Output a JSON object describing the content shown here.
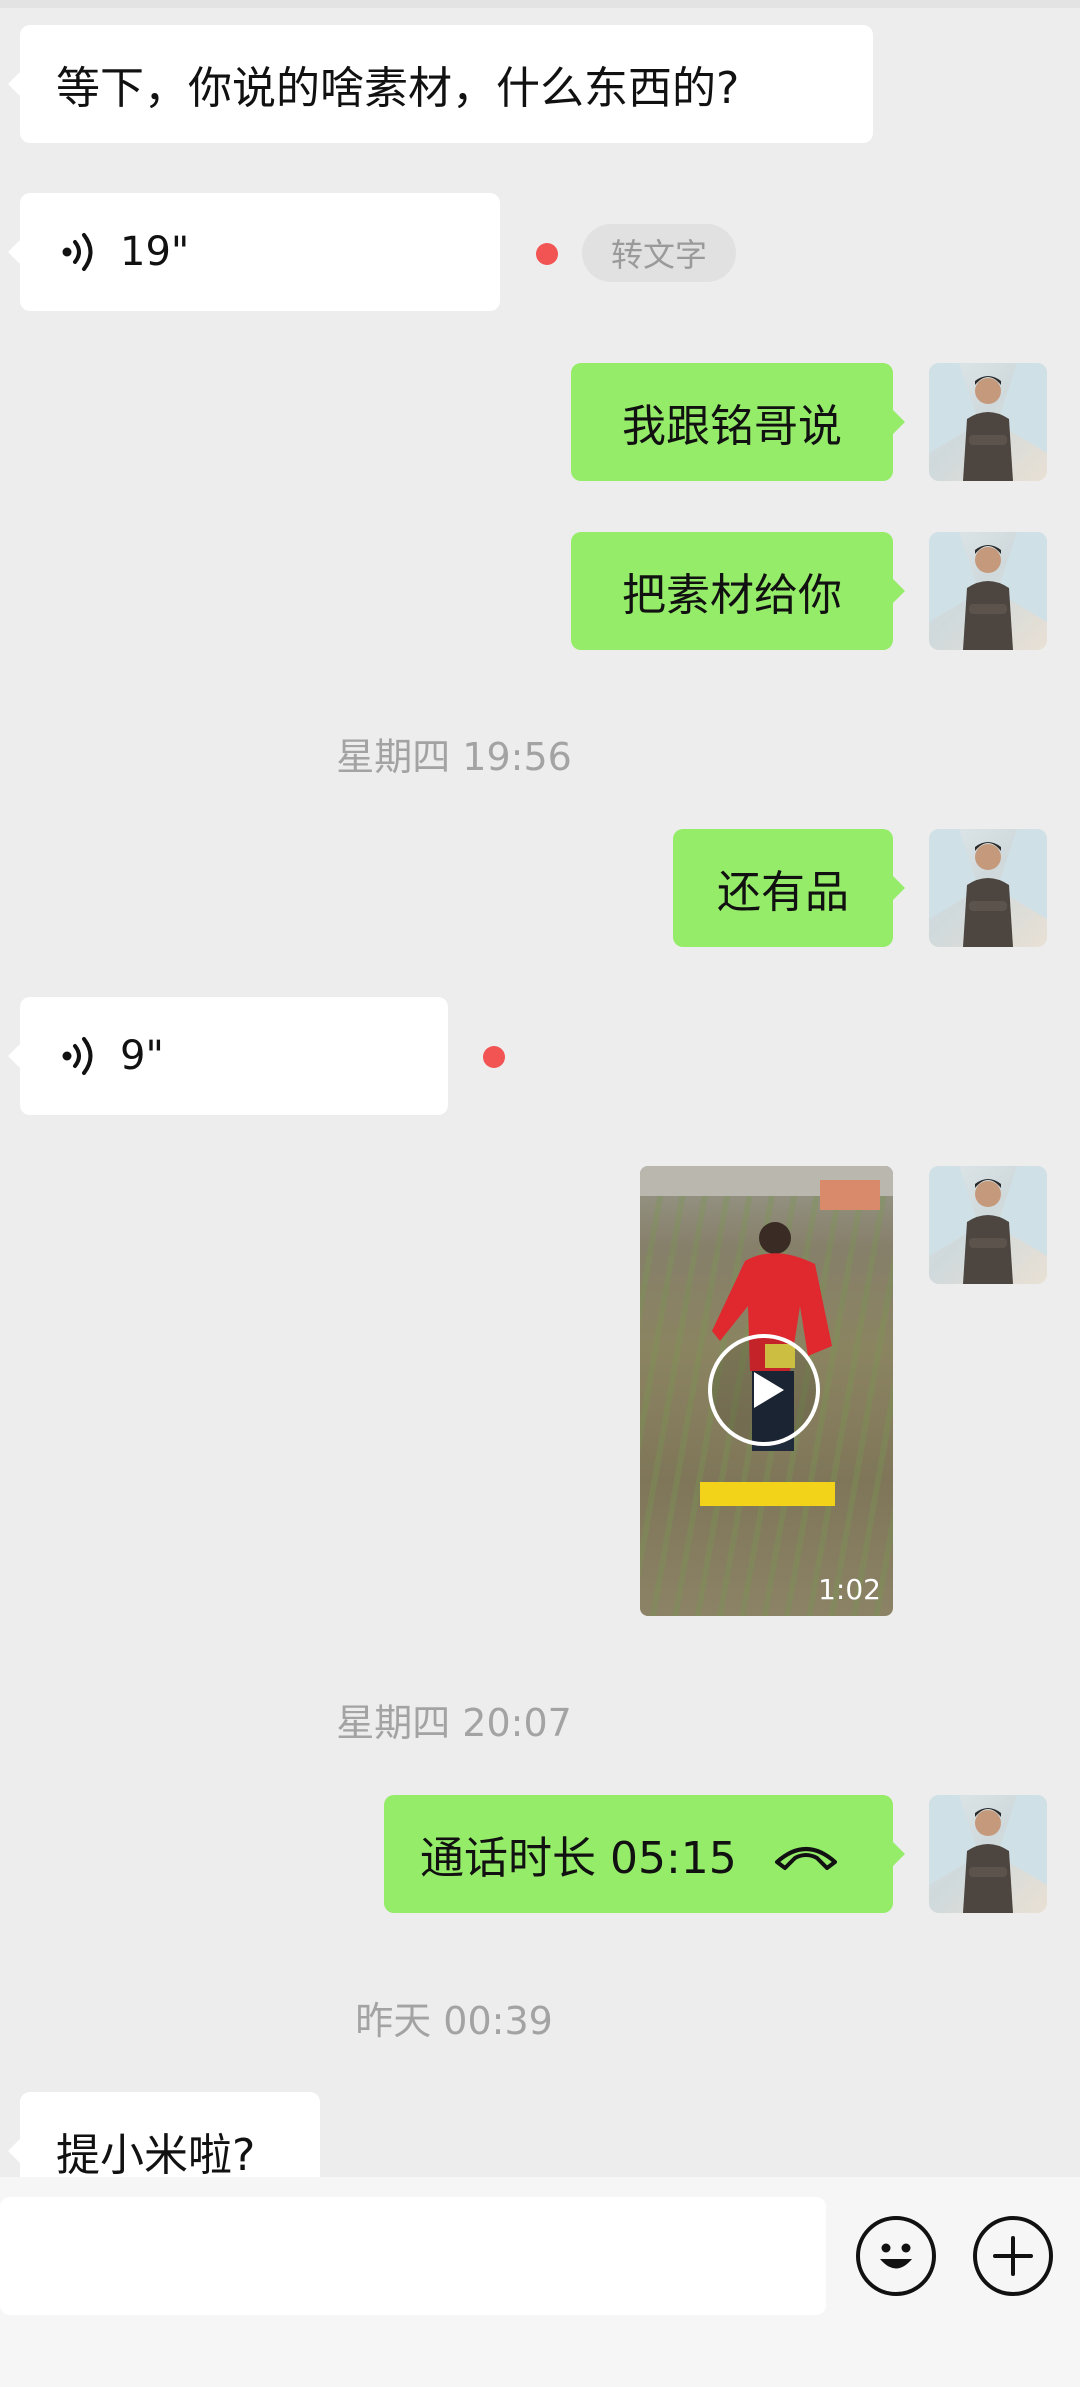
{
  "messages": {
    "m1": "等下，你说的啥素材，什么东西的?",
    "voice1_duration": "19\"",
    "to_text_label": "转文字",
    "m2": "我跟铭哥说",
    "m3": "把素材给你",
    "ts1": "星期四 19:56",
    "m4": "还有品",
    "voice2_duration": "9\"",
    "video_duration": "1:02",
    "ts2": "星期四 20:07",
    "call_text": "通话时长 05:15",
    "ts3": "昨天 00:39",
    "m5": "提小米啦?"
  },
  "colors": {
    "background": "#ededed",
    "incoming_bubble": "#ffffff",
    "outgoing_bubble": "#95ec69",
    "unread_dot": "#f25353",
    "timestamp_text": "#a3a3a3"
  },
  "icons": [
    "voice-wave-icon",
    "play-icon",
    "hang-up-phone-icon",
    "emoji-icon",
    "plus-icon"
  ]
}
